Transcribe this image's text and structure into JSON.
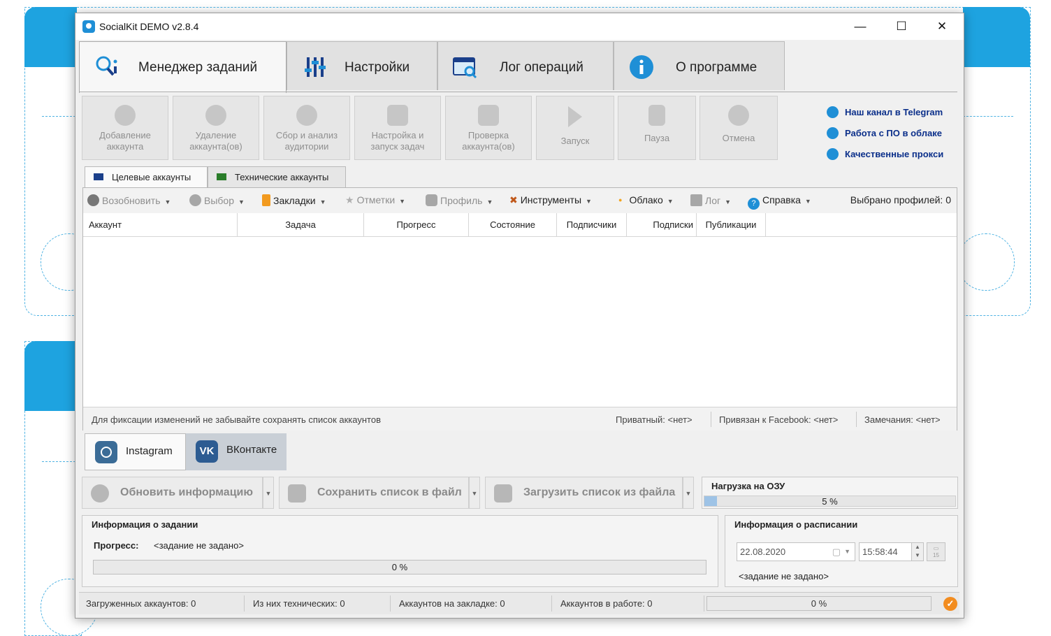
{
  "window": {
    "title": "SocialKit DEMO v2.8.4",
    "controls": {
      "minimize": "—",
      "maximize": "☐",
      "close": "✕"
    }
  },
  "main_tabs": [
    {
      "label": "Менеджер заданий",
      "icon": "task-manager-search-icon",
      "active": true
    },
    {
      "label": "Настройки",
      "icon": "sliders-icon",
      "active": false
    },
    {
      "label": "Лог операций",
      "icon": "log-calendar-icon",
      "active": false
    },
    {
      "label": "О программе",
      "icon": "info-icon",
      "active": false
    }
  ],
  "toolbar_buttons": [
    {
      "label": "Добавление аккаунта",
      "icon": "add-account-icon",
      "enabled": false
    },
    {
      "label": "Удаление аккаунта(ов)",
      "icon": "remove-account-icon",
      "enabled": false
    },
    {
      "label": "Сбор и анализ аудитории",
      "icon": "audience-icon",
      "enabled": false
    },
    {
      "label": "Настройка и запуск задач",
      "icon": "task-setup-icon",
      "enabled": false
    },
    {
      "label": "Проверка аккаунта(ов)",
      "icon": "check-account-icon",
      "enabled": false
    },
    {
      "label": "Запуск",
      "icon": "play-icon",
      "enabled": false
    },
    {
      "label": "Пауза",
      "icon": "pause-icon",
      "enabled": false
    },
    {
      "label": "Отмена",
      "icon": "cancel-icon",
      "enabled": false
    }
  ],
  "links": [
    {
      "label": "Наш канал в Telegram",
      "icon": "telegram-icon"
    },
    {
      "label": "Работа с ПО в облаке",
      "icon": "cloud-user-icon"
    },
    {
      "label": "Качественные прокси",
      "icon": "globe-icon"
    }
  ],
  "sub_tabs": [
    {
      "label": "Целевые аккаунты",
      "active": true
    },
    {
      "label": "Технические аккаунты",
      "active": false
    }
  ],
  "grid_toolbar": {
    "items": [
      {
        "label": "Возобновить",
        "icon": "resume-icon",
        "enabled": false
      },
      {
        "label": "Выбор",
        "icon": "select-check-icon",
        "enabled": false
      },
      {
        "label": "Закладки",
        "icon": "bookmark-icon",
        "enabled": true
      },
      {
        "label": "Отметки",
        "icon": "star-icon",
        "enabled": false
      },
      {
        "label": "Профиль",
        "icon": "instagram-profile-icon",
        "enabled": false
      },
      {
        "label": "Инструменты",
        "icon": "tools-icon",
        "enabled": true
      },
      {
        "label": "Облако",
        "icon": "cloud-dot-icon",
        "enabled": true
      },
      {
        "label": "Лог",
        "icon": "log-icon",
        "enabled": false
      },
      {
        "label": "Справка",
        "icon": "help-icon",
        "enabled": true
      }
    ],
    "selected_profiles": "Выбрано профилей: 0"
  },
  "grid_columns": [
    "Аккаунт",
    "Задача",
    "Прогресс",
    "Состояние",
    "Подписчики",
    "Подписки",
    "Публикации"
  ],
  "grid_footer": {
    "hint": "Для фиксации изменений не забывайте сохранять список аккаунтов",
    "private": "Приватный:  <нет>",
    "facebook": "Привязан к Facebook:  <нет>",
    "remarks": "Замечания:  <нет>"
  },
  "social_tabs": [
    {
      "label": "Instagram",
      "icon": "instagram-icon",
      "active": true
    },
    {
      "label": "ВКонтакте",
      "icon": "vk-icon",
      "active": false
    }
  ],
  "actions": [
    {
      "label": "Обновить информацию",
      "icon": "refresh-icon"
    },
    {
      "label": "Сохранить список в файл",
      "icon": "save-icon"
    },
    {
      "label": "Загрузить список из файла",
      "icon": "load-file-icon"
    }
  ],
  "ram": {
    "title": "Нагрузка на ОЗУ",
    "value_text": "5 %",
    "fraction": 0.05
  },
  "task_info": {
    "title": "Информация о задании",
    "progress_label": "Прогресс:",
    "progress_value": "<задание не задано>",
    "progress_text": "0 %",
    "fraction": 0
  },
  "schedule_info": {
    "title": "Информация о расписании",
    "date": "22.08.2020",
    "time": "15:58:44",
    "calendar_day": "15",
    "status": "<задание не задано>"
  },
  "status_bar": {
    "loaded": "Загруженных аккаунтов: 0",
    "technical": "Из них технических: 0",
    "bookmarked": "Аккаунтов на закладке: 0",
    "working": "Аккаунтов в работе: 0",
    "progress_text": "0 %",
    "check": "✓"
  },
  "colors": {
    "accent": "#1f8fd6",
    "background_band": "#1ea3e0",
    "status_ok": "#f28c1f"
  }
}
